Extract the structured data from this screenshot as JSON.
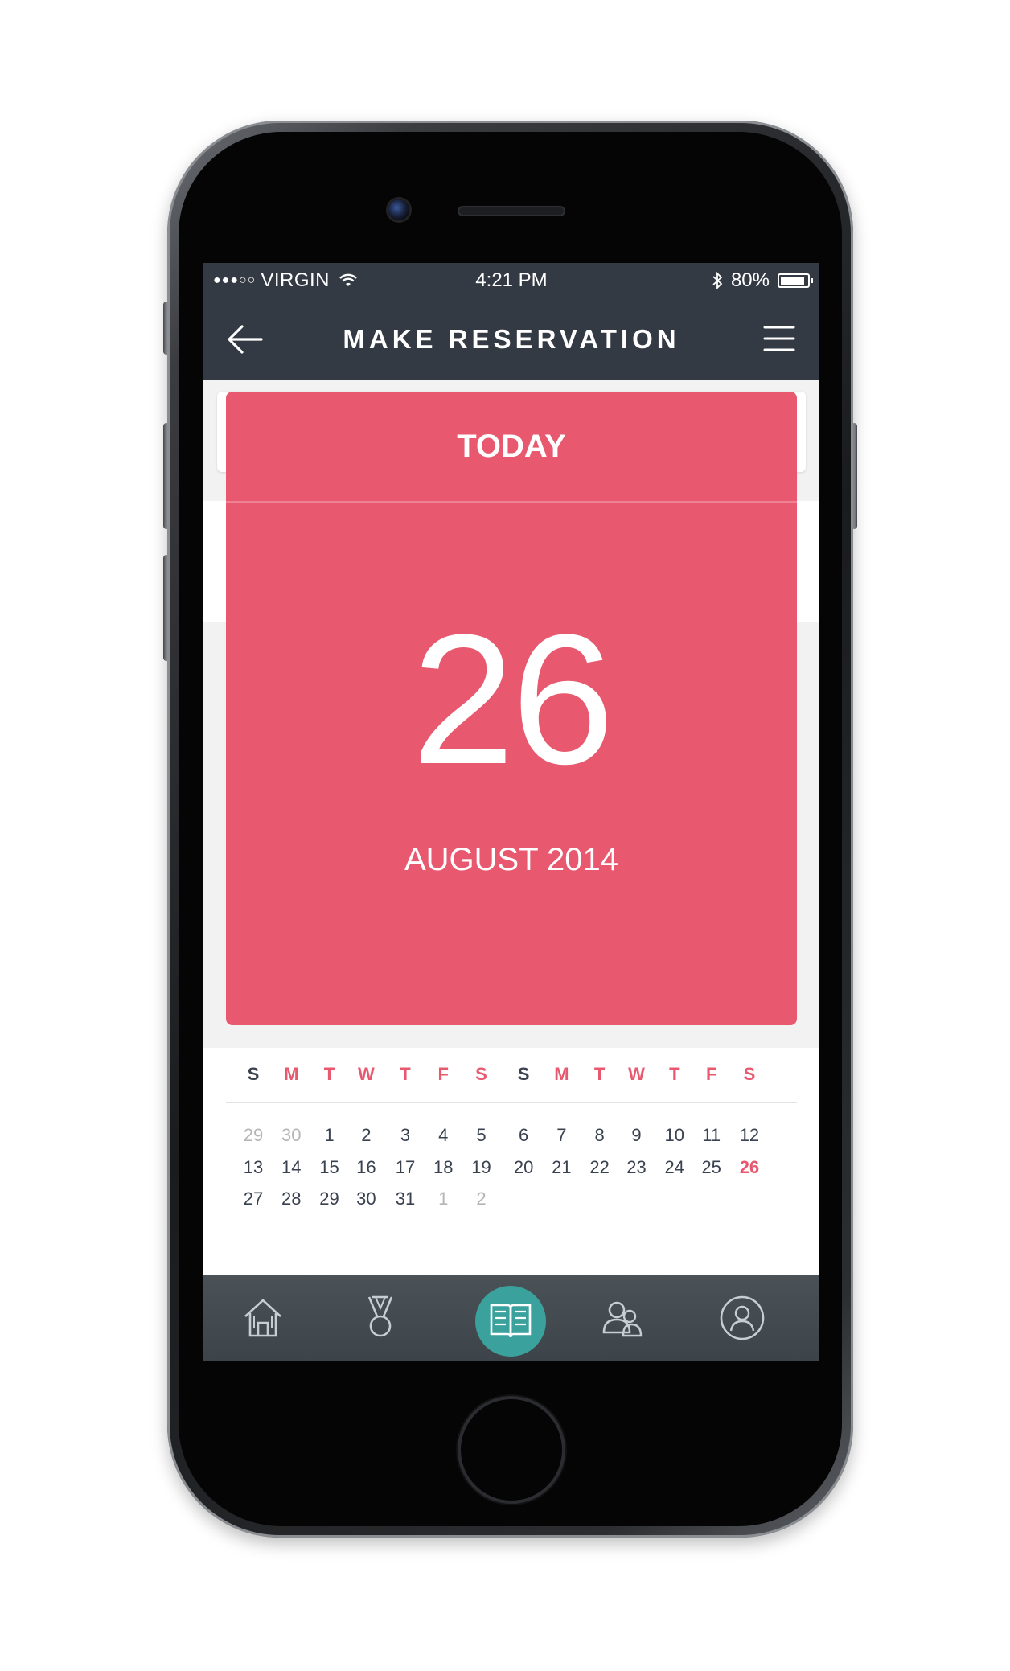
{
  "status_bar": {
    "signal": "●●●○○",
    "carrier": "VIRGIN",
    "time": "4:21 PM",
    "bluetooth": "bluetooth-icon",
    "battery": "80%"
  },
  "nav": {
    "title": "MAKE RESERVATION",
    "back_icon": "back-arrow-icon",
    "menu_icon": "hamburger-menu-icon"
  },
  "date_card": {
    "label": "TODAY",
    "day": "26",
    "month_year": "AUGUST 2014",
    "color": "#e8586e"
  },
  "calendar": {
    "weekdays": [
      "S",
      "M",
      "T",
      "W",
      "T",
      "F",
      "S",
      "S",
      "M",
      "T",
      "W",
      "T",
      "F",
      "S"
    ],
    "weeks": [
      [
        "29",
        "30",
        "1",
        "2",
        "3",
        "4",
        "5",
        "6",
        "7",
        "8",
        "9",
        "10",
        "11",
        "12"
      ],
      [
        "13",
        "14",
        "15",
        "16",
        "17",
        "18",
        "19",
        "20",
        "21",
        "22",
        "23",
        "24",
        "25",
        "26"
      ],
      [
        "27",
        "28",
        "29",
        "30",
        "31",
        "1",
        "2"
      ]
    ],
    "selected": "26",
    "accent": "#e8586e"
  },
  "tabbar": {
    "items": [
      {
        "icon": "home-icon",
        "active": false
      },
      {
        "icon": "medal-icon",
        "active": false
      },
      {
        "icon": "book-icon",
        "active": true
      },
      {
        "icon": "group-icon",
        "active": false
      },
      {
        "icon": "profile-icon",
        "active": false
      }
    ],
    "active_color": "#3aa19d"
  }
}
